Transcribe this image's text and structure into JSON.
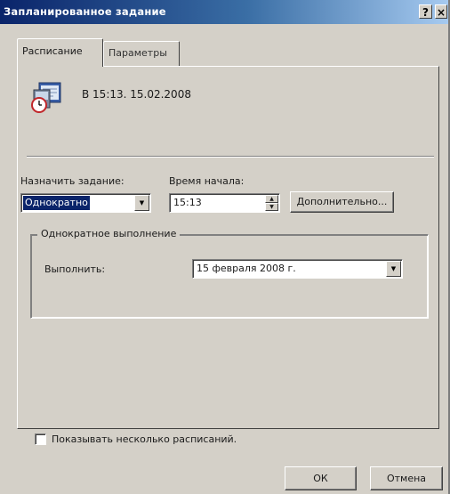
{
  "window": {
    "title": "Запланированное задание",
    "help_glyph": "?",
    "close_glyph": "×"
  },
  "tabs": [
    {
      "label": "Расписание"
    },
    {
      "label": "Параметры"
    }
  ],
  "summary": {
    "icon": "scheduled-task-icon",
    "text": "В 15:13. 15.02.2008"
  },
  "schedule": {
    "schedule_label": "Назначить задание:",
    "schedule_value": "Однократно",
    "start_time_label": "Время начала:",
    "start_time_value": "15:13",
    "advanced_button": "Дополнительно..."
  },
  "once_group": {
    "legend": "Однократное выполнение",
    "run_label": "Выполнить:",
    "run_date": "15 февраля 2008 г."
  },
  "options": {
    "multiple_schedules_label": "Показывать несколько расписаний.",
    "multiple_schedules_checked": false
  },
  "buttons": {
    "ok": "ОК",
    "cancel": "Отмена"
  },
  "colors": {
    "title_gradient_start": "#0a246a",
    "title_gradient_end": "#a6caf0",
    "face": "#d4d0c8",
    "selection": "#0a246a"
  }
}
